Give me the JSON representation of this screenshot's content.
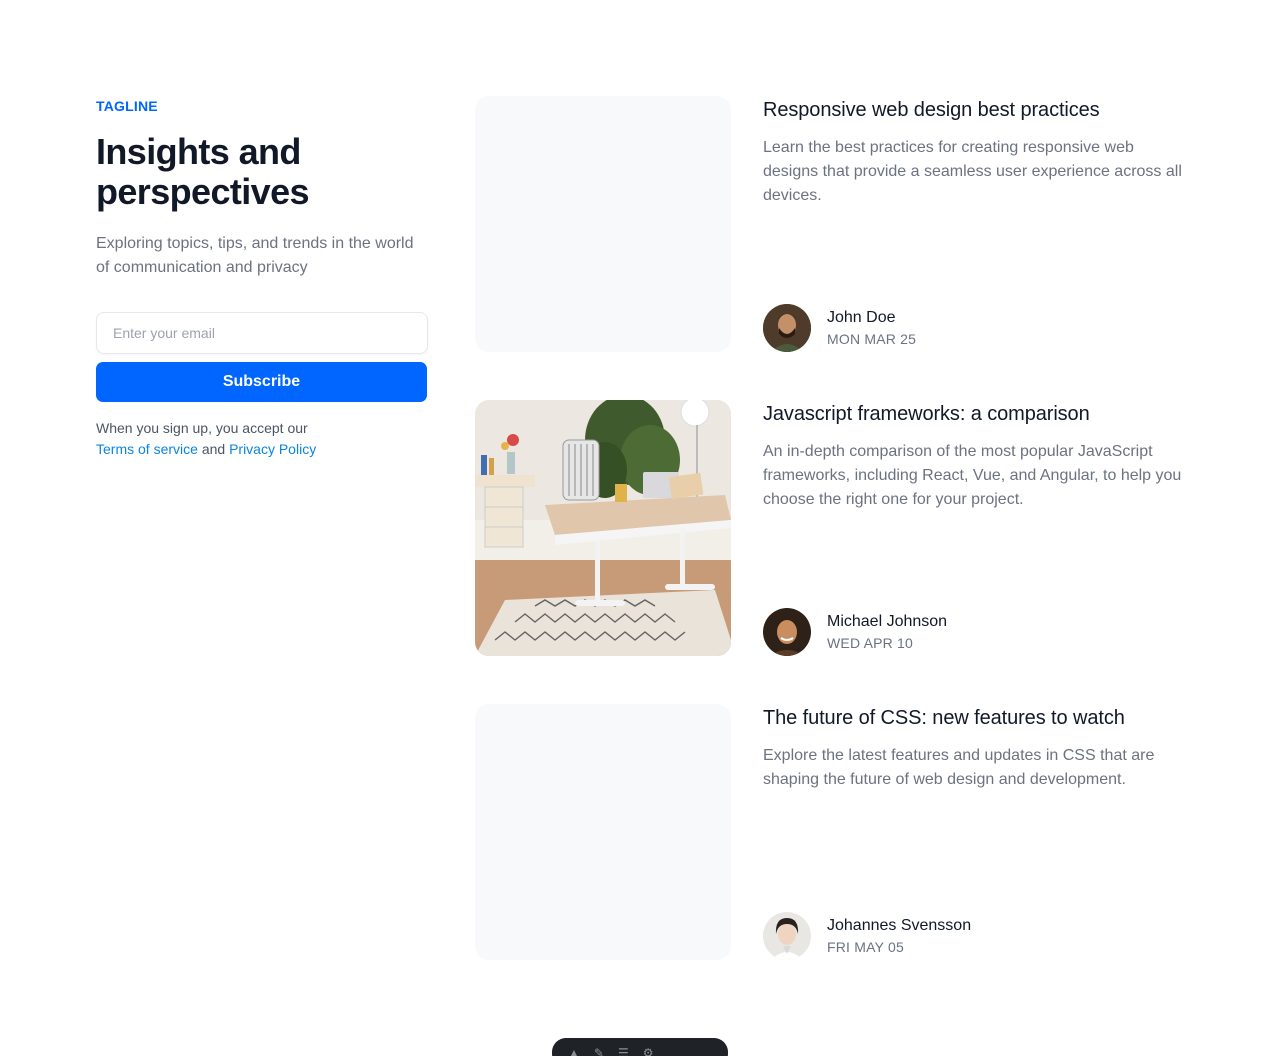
{
  "sidebar": {
    "tagline": "TAGLINE",
    "heading": "Insights and perspectives",
    "subtext": "Exploring topics, tips, and trends in the world of communication and privacy",
    "email_placeholder": "Enter your email",
    "subscribe_label": "Subscribe",
    "legal_prefix": "When you sign up, you accept our",
    "terms_label": "Terms of service",
    "legal_and": "and",
    "privacy_label": "Privacy Policy"
  },
  "posts": [
    {
      "title": "Responsive web design best practices",
      "excerpt": "Learn the best practices for creating responsive web designs that provide a seamless user experience across all devices.",
      "author": "John Doe",
      "date": "MON MAR 25",
      "image": "none"
    },
    {
      "title": "Javascript frameworks: a comparison",
      "excerpt": "An in-depth comparison of the most popular JavaScript frameworks, including React, Vue, and Angular, to help you choose the right one for your project.",
      "author": "Michael Johnson",
      "date": "WED APR 10",
      "image": "office-desk-photo"
    },
    {
      "title": "The future of CSS: new features to watch",
      "excerpt": "Explore the latest features and updates in CSS that are shaping the future of web design and development.",
      "author": "Johannes Svensson",
      "date": "FRI MAY 05",
      "image": "none"
    }
  ],
  "colors": {
    "accent": "#0066ff",
    "link": "#0a84e0",
    "heading": "#111827",
    "muted": "#6b7280",
    "image_placeholder": "#f8f9fb"
  }
}
